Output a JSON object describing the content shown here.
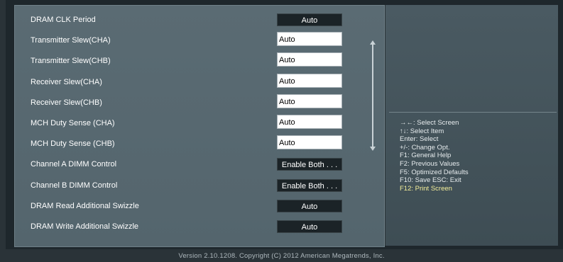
{
  "settings": [
    {
      "label": "DRAM CLK Period",
      "value": "Auto",
      "style": "dark"
    },
    {
      "label": "Transmitter Slew(CHA)",
      "value": "Auto",
      "style": "white"
    },
    {
      "label": "Transmitter Slew(CHB)",
      "value": "Auto",
      "style": "white"
    },
    {
      "label": "Receiver Slew(CHA)",
      "value": "Auto",
      "style": "white"
    },
    {
      "label": "Receiver Slew(CHB)",
      "value": "Auto",
      "style": "white"
    },
    {
      "label": "MCH Duty Sense (CHA)",
      "value": "Auto",
      "style": "white"
    },
    {
      "label": "MCH Duty Sense (CHB)",
      "value": "Auto",
      "style": "white"
    },
    {
      "label": "Channel A DIMM Control",
      "value": "Enable Both . . .",
      "style": "dark"
    },
    {
      "label": "Channel B DIMM Control",
      "value": "Enable Both . . .",
      "style": "dark"
    },
    {
      "label": "DRAM Read Additional Swizzle",
      "value": "Auto",
      "style": "dark"
    },
    {
      "label": "DRAM Write Additional Swizzle",
      "value": "Auto",
      "style": "dark"
    }
  ],
  "help": [
    "→←: Select Screen",
    "↑↓: Select Item",
    "Enter: Select",
    "+/-: Change Opt.",
    "F1: General Help",
    "F2: Previous Values",
    "F5: Optimized Defaults",
    "F10: Save   ESC: Exit",
    "F12: Print Screen"
  ],
  "footer": "Version  2.10.1208.  Copyright  (C)  2012  American  Megatrends,  Inc.",
  "colors": {
    "panel": "#5a6b73",
    "highlight": "#f3ee9a",
    "help_text": "#e7ecee"
  }
}
